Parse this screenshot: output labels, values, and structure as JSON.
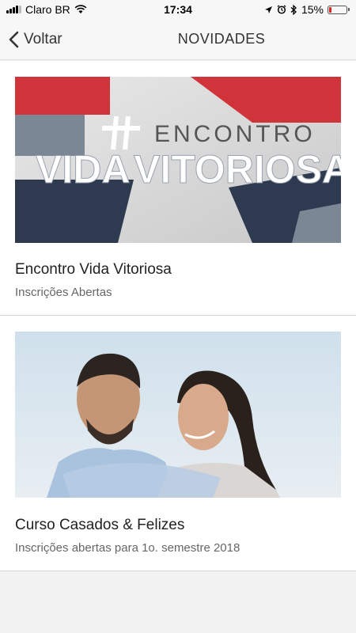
{
  "status_bar": {
    "carrier": "Claro BR",
    "time": "17:34",
    "battery_percent": "15%",
    "battery_level": 0.15,
    "icons": [
      "signal-icon",
      "wifi-icon",
      "location-icon",
      "alarm-icon",
      "bluetooth-icon",
      "battery-icon"
    ]
  },
  "nav": {
    "back_label": "Voltar",
    "title": "NOVIDADES"
  },
  "cards": [
    {
      "title": "Encontro Vida Vitoriosa",
      "subtitle": "Inscrições Abertas",
      "image_text": {
        "top": "ENCONTRO",
        "bottom_left": "VIDA",
        "bottom_right": "VITORIOSA"
      }
    },
    {
      "title": "Curso Casados & Felizes",
      "subtitle": "Inscrições abertas para 1o. semestre 2018"
    }
  ],
  "colors": {
    "accent_red": "#d0343a",
    "navy": "#2d3a4f",
    "battery_low": "#e02020"
  }
}
